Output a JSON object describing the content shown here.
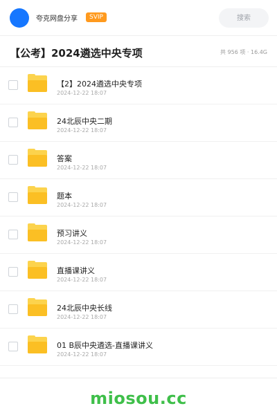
{
  "topbar": {
    "brand": "夸克网盘分享",
    "badge": "SVIP",
    "search_placeholder": "搜索"
  },
  "header": {
    "title": "【公考】2024遴选中央专项",
    "meta": "共 956 项 · 16.4G"
  },
  "files": [
    {
      "name": "【2】2024遴选中央专项",
      "date": "2024-12-22 18:07"
    },
    {
      "name": "24北辰中央二期",
      "date": "2024-12-22 18:07"
    },
    {
      "name": "答案",
      "date": "2024-12-22 18:07"
    },
    {
      "name": "题本",
      "date": "2024-12-22 18:07"
    },
    {
      "name": "预习讲义",
      "date": "2024-12-22 18:07"
    },
    {
      "name": "直播课讲义",
      "date": "2024-12-22 18:07"
    },
    {
      "name": "24北辰中央长线",
      "date": "2024-12-22 18:07"
    },
    {
      "name": "01 B辰中央遴选-直播课讲义",
      "date": "2024-12-22 18:07"
    }
  ],
  "watermark": "miosou.cc",
  "colors": {
    "accent": "#1677ff",
    "badge": "#ff9a1e",
    "folder": "#fbbf24",
    "watermark": "#3fbf4a"
  },
  "icons": {
    "avatar": "user-avatar-circle",
    "folder": "folder-icon",
    "checkbox": "checkbox-icon"
  }
}
